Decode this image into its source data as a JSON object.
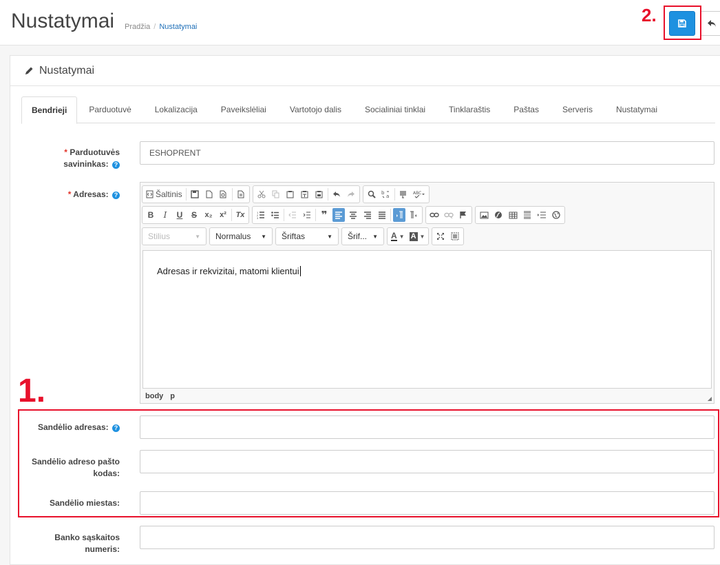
{
  "header": {
    "title": "Nustatymai",
    "breadcrumb": {
      "home": "Pradžia",
      "separator": "/",
      "current": "Nustatymai"
    }
  },
  "annotations": {
    "step1": "1.",
    "step2": "2.",
    "color": "#e8102b"
  },
  "buttons": {
    "save_icon": "floppy-disk-icon",
    "back_icon": "reply-arrow-icon",
    "save_color": "#1e91e0"
  },
  "panel": {
    "heading": "Nustatymai",
    "heading_icon": "pencil-icon"
  },
  "tabs": [
    {
      "label": "Bendrieji",
      "active": true
    },
    {
      "label": "Parduotuvė"
    },
    {
      "label": "Lokalizacija"
    },
    {
      "label": "Paveikslėliai"
    },
    {
      "label": "Vartotojo dalis"
    },
    {
      "label": "Socialiniai tinklai"
    },
    {
      "label": "Tinklaraštis"
    },
    {
      "label": "Paštas"
    },
    {
      "label": "Serveris"
    },
    {
      "label": "Nustatymai"
    }
  ],
  "form": {
    "owner": {
      "required_mark": "*",
      "label_line1": "Parduotuvės",
      "label_line2": "savininkas:",
      "value": "ESHOPRENT"
    },
    "address": {
      "required_mark": "*",
      "label": "Adresas:"
    },
    "warehouse_address": {
      "label": "Sandėlio adresas:",
      "value": ""
    },
    "warehouse_postcode": {
      "label_line1": "Sandėlio adreso pašto",
      "label_line2": "kodas:",
      "value": ""
    },
    "warehouse_city": {
      "label": "Sandėlio miestas:",
      "value": ""
    },
    "bank_account": {
      "label_line1": "Banko sąskaitos",
      "label_line2": "numeris:",
      "value": ""
    }
  },
  "editor": {
    "source_label": "Šaltinis",
    "style_combo": "Stilius",
    "format_combo": "Normalus",
    "font_combo": "Šriftas",
    "size_combo": "Šrif...",
    "content": "Adresas ir rekvizitai, matomi klientui",
    "path": [
      "body",
      "p"
    ],
    "toolbar_row2": {
      "bold": "B",
      "italic": "I",
      "underline": "U",
      "strike": "S",
      "sub": "x₂",
      "sup": "x²",
      "clear": "Tx"
    },
    "font_color": "A",
    "bg_color": "A"
  },
  "help_mark": "?"
}
